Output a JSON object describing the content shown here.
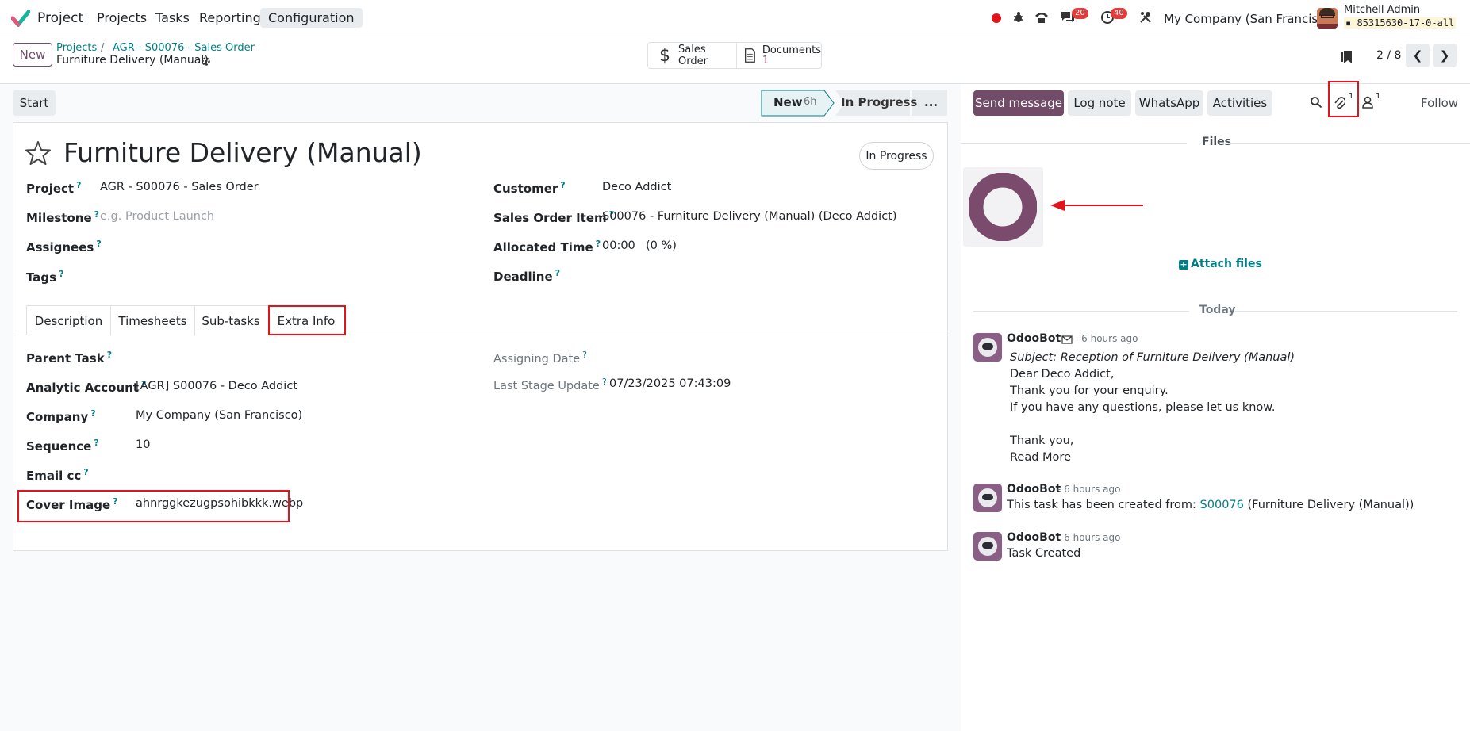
{
  "nav": {
    "app_name": "Project",
    "menu": [
      "Projects",
      "Tasks",
      "Reporting",
      "Configuration"
    ],
    "discuss_badge": "20",
    "activity_badge": "40",
    "company": "My Company (San Francisco)",
    "user_name": "Mitchell Admin",
    "db_name": "85315630-17-0-all"
  },
  "control": {
    "new_label": "New",
    "breadcrumb": [
      "Projects",
      "AGR - S00076 - Sales Order"
    ],
    "record_title": "Furniture Delivery (Manual)",
    "smart_sales_order": "Sales Order",
    "smart_documents_label": "Documents",
    "smart_documents_count": "1",
    "pager": "2 / 8"
  },
  "statusbar": {
    "start_label": "Start",
    "stages": [
      "New",
      "In Progress",
      "..."
    ],
    "new_duration": "6h"
  },
  "form": {
    "title": "Furniture Delivery (Manual)",
    "state": "In Progress",
    "project_label": "Project",
    "project_value": "AGR - S00076 - Sales Order",
    "milestone_label": "Milestone",
    "milestone_placeholder": "e.g. Product Launch",
    "assignees_label": "Assignees",
    "tags_label": "Tags",
    "customer_label": "Customer",
    "customer_value": "Deco Addict",
    "so_item_label": "Sales Order Item",
    "so_item_value": "S00076 - Furniture Delivery (Manual) (Deco Addict)",
    "allocated_label": "Allocated Time",
    "allocated_value": "00:00",
    "allocated_pct": "(0 %)",
    "deadline_label": "Deadline",
    "tabs": [
      "Description",
      "Timesheets",
      "Sub-tasks",
      "Extra Info"
    ],
    "parent_task_label": "Parent Task",
    "analytic_label": "Analytic Account",
    "analytic_value": "[AGR] S00076 - Deco Addict",
    "company_label": "Company",
    "company_value": "My Company (San Francisco)",
    "sequence_label": "Sequence",
    "sequence_value": "10",
    "email_cc_label": "Email cc",
    "cover_label": "Cover Image",
    "cover_value": "ahnrggkezugpsohibkkk.webp",
    "assigning_date_label": "Assigning Date",
    "last_stage_label": "Last Stage Update",
    "last_stage_value": "07/23/2025 07:43:09",
    "q": "?"
  },
  "chatter": {
    "send_message": "Send message",
    "log_note": "Log note",
    "whatsapp": "WhatsApp",
    "activities": "Activities",
    "attachments_count": "1",
    "followers_count": "1",
    "follow": "Follow",
    "files_heading": "Files",
    "attach_files": "Attach files",
    "today": "Today",
    "messages": [
      {
        "author": "OdooBot",
        "time": "- 6 hours ago",
        "subject": "Subject: Reception of Furniture Delivery (Manual)",
        "lines": [
          "Dear Deco Addict,",
          "Thank you for your enquiry.",
          "If you have any questions, please let us know.",
          "Thank you,"
        ],
        "read_more": "Read More"
      },
      {
        "author": "OdooBot",
        "time": "- 6 hours ago",
        "text_before": "This task has been created from: ",
        "link": "S00076",
        "text_after": " (Furniture Delivery (Manual))"
      },
      {
        "author": "OdooBot",
        "time": "- 6 hours ago",
        "text": "Task Created"
      }
    ]
  },
  "colors": {
    "brand": "#714b67",
    "link": "#017e84",
    "annotation": "#e3131b"
  }
}
